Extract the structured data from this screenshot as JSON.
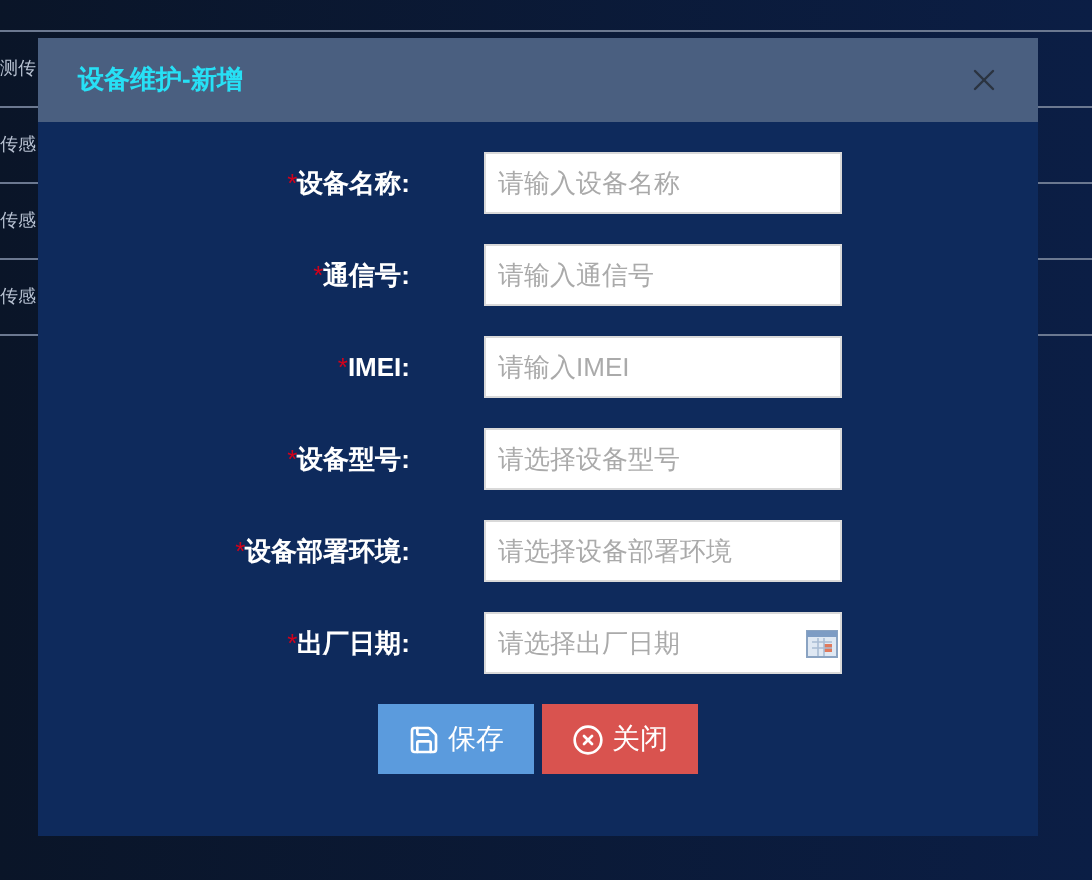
{
  "background_rows": [
    {
      "label": "测传"
    },
    {
      "label": "传感"
    },
    {
      "label": "传感"
    },
    {
      "label": "传感"
    }
  ],
  "dialog": {
    "title": "设备维护-新增",
    "fields": [
      {
        "required_mark": "*",
        "label": "设备名称:",
        "placeholder": "请输入设备名称",
        "kind": "text"
      },
      {
        "required_mark": "*",
        "label": "通信号:",
        "placeholder": "请输入通信号",
        "kind": "text"
      },
      {
        "required_mark": "*",
        "label": "IMEI:",
        "placeholder": "请输入IMEI",
        "kind": "text"
      },
      {
        "required_mark": "*",
        "label": "设备型号:",
        "placeholder": "请选择设备型号",
        "kind": "select"
      },
      {
        "required_mark": "*",
        "label": "设备部署环境:",
        "placeholder": "请选择设备部署环境",
        "kind": "select"
      },
      {
        "required_mark": "*",
        "label": "出厂日期:",
        "placeholder": "请选择出厂日期",
        "kind": "date"
      }
    ],
    "buttons": [
      {
        "label": "保存",
        "kind": "save"
      },
      {
        "label": "关闭",
        "kind": "close"
      }
    ]
  }
}
